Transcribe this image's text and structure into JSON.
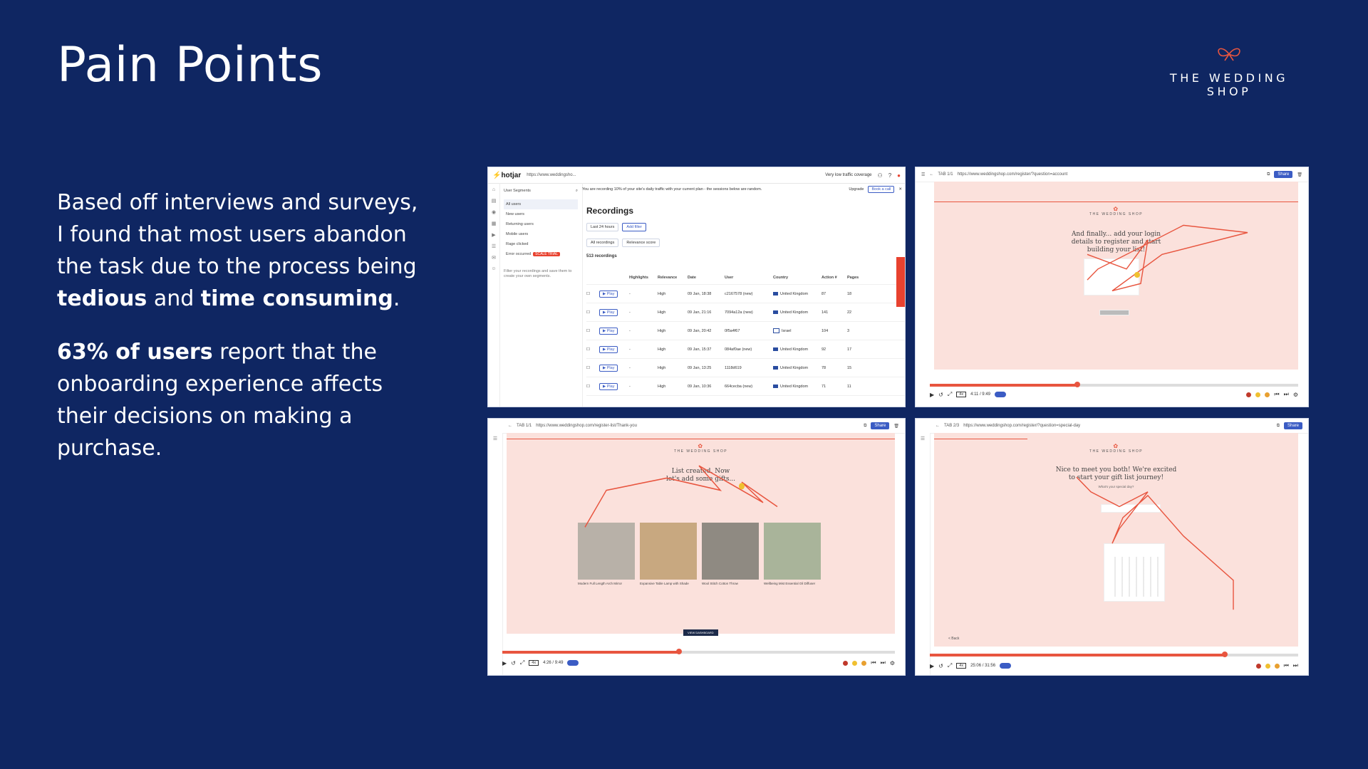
{
  "slide": {
    "title": "Pain Points",
    "brand": {
      "name": "THE WEDDING SHOP",
      "logo_icon": "bow-icon"
    },
    "paragraph1": {
      "intro": "Based off interviews and surveys, I found that most users abandon the task due to the process being ",
      "bold1": "tedious",
      "mid": " and ",
      "bold2": "time consuming",
      "end": "."
    },
    "paragraph2": {
      "bold": "63% of users",
      "rest": " report that the onboarding experience affects their decisions on making a purchase."
    }
  },
  "hotjar": {
    "logo": "hotjar",
    "url": "https://www.weddingsho...",
    "coverage": "Very low traffic coverage",
    "banner": "You are recording 10% of your site's daily traffic with your current plan - the sessions below are random.",
    "upgrade": "Upgrade",
    "book_call": "Book a call",
    "sidebar": {
      "header": "User Segments",
      "items": [
        "All users",
        "New users",
        "Returning users",
        "Mobile users",
        "Rage clicked",
        "Error occurred"
      ],
      "badge": "SCALE TRIAL",
      "help": "Filter your recordings and save them to create your own segments."
    },
    "heading": "Recordings",
    "filters": [
      "Last 24 hours",
      "Add filter",
      "All recordings",
      "Relevance score"
    ],
    "count": "513 recordings",
    "columns": [
      "",
      "Highlights",
      "Relevance",
      "Date",
      "User",
      "Country",
      "Action #",
      "Pages"
    ],
    "play_label": "Play",
    "rows": [
      {
        "hl": "-",
        "rel": "High",
        "date": "09 Jan, 18:38",
        "user": "c2167578 (new)",
        "country": "United Kingdom",
        "actions": "87",
        "pages": "18"
      },
      {
        "hl": "-",
        "rel": "High",
        "date": "09 Jan, 21:16",
        "user": "7094a12a (new)",
        "country": "United Kingdom",
        "actions": "141",
        "pages": "22"
      },
      {
        "hl": "-",
        "rel": "High",
        "date": "09 Jan, 20:42",
        "user": "0f5a4f67",
        "country": "Israel",
        "actions": "104",
        "pages": "3"
      },
      {
        "hl": "-",
        "rel": "High",
        "date": "09 Jan, 15:37",
        "user": "084af0ae (new)",
        "country": "United Kingdom",
        "actions": "92",
        "pages": "17"
      },
      {
        "hl": "-",
        "rel": "High",
        "date": "09 Jan, 13:25",
        "user": "1118d619",
        "country": "United Kingdom",
        "actions": "78",
        "pages": "15"
      },
      {
        "hl": "-",
        "rel": "High",
        "date": "09 Jan, 10:36",
        "user": "664cecba (new)",
        "country": "United Kingdom",
        "actions": "71",
        "pages": "11"
      }
    ]
  },
  "playbacks": [
    {
      "tab": "TAB 1/1",
      "url": "https://www.weddingshop.com/register/?question=account",
      "share": "Share",
      "logo": "THE WEDDING SHOP",
      "heading": "And finally... add your login details to register and start building your list!",
      "time": "4:11 / 9:49",
      "speed": "4x",
      "progress": 0.4
    },
    {
      "tab": "TAB 1/1",
      "url": "https://www.weddingshop.com/register-list/Thank-you",
      "share": "Share",
      "logo": "THE WEDDING SHOP",
      "heading": "List created. Now let's add some gifts...",
      "time": "4:26 / 9:49",
      "speed": "4x",
      "progress": 0.45,
      "products": [
        "Modern Full Length Arch Mirror",
        "Expansive Table Lamp with Shade",
        "Wool Stitch Cotton Throw",
        "Wellbeing Mist Essential Oil Diffuser"
      ],
      "cta": "VIEW DASHBOARD"
    },
    {
      "tab": "TAB 2/3",
      "url": "https://www.weddingshop.com/register/?question=special-day",
      "share": "Share",
      "logo": "THE WEDDING SHOP",
      "heading": "Nice to meet you both! We're excited to start your gift list journey!",
      "subheading": "What's your special day?",
      "back": "< Back",
      "time": "25:06 / 31:56",
      "speed": "4x",
      "progress": 0.8
    }
  ]
}
